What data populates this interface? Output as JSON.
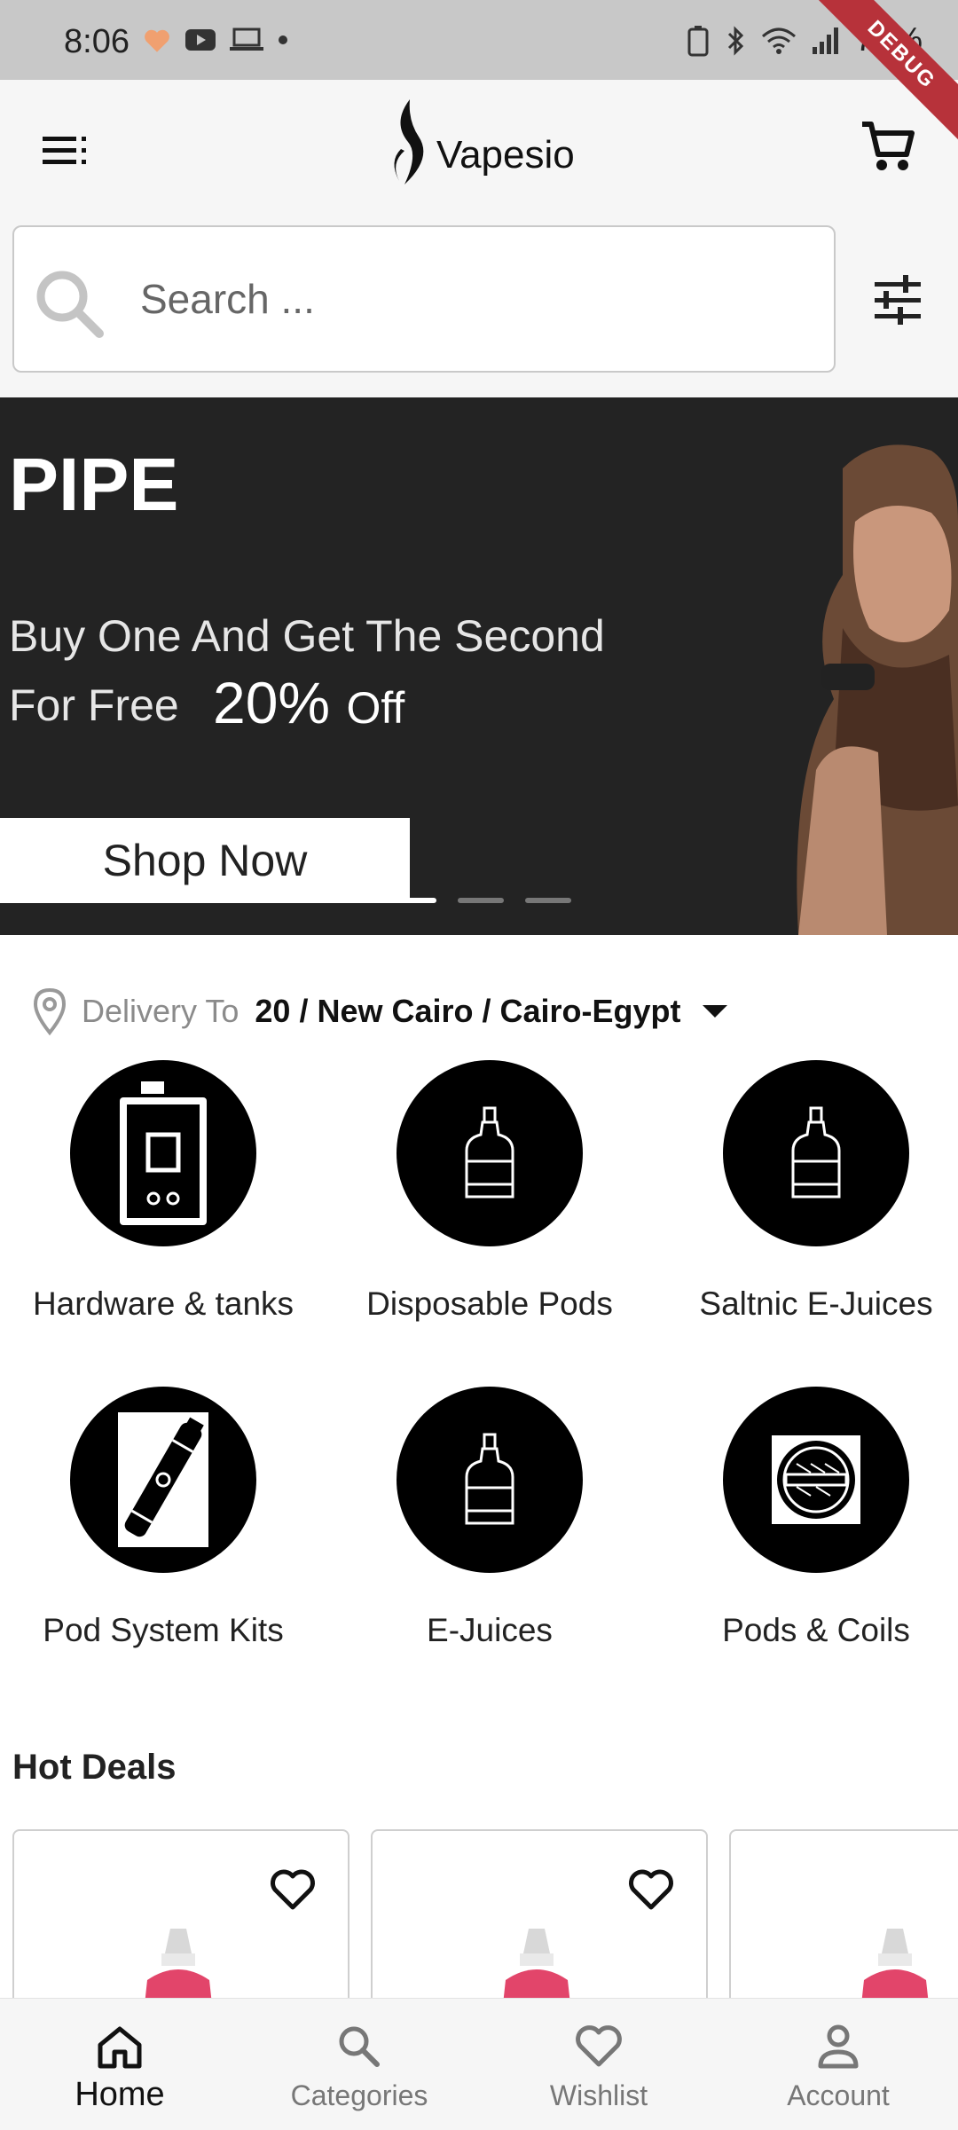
{
  "status_bar": {
    "time": "8:06",
    "battery": "72%"
  },
  "debug_ribbon": "DEBUG",
  "app_bar": {
    "logo_text": "Vapesio",
    "menu_icon": "menu-icon",
    "cart_icon": "cart-icon"
  },
  "search": {
    "placeholder": "Search ...",
    "filter_icon": "filter-icon"
  },
  "banner": {
    "headline": "PIPE",
    "line1": "Buy One And Get The Second",
    "line2": "For Free",
    "discount": "20%",
    "discount_suffix": "Off",
    "cta": "Shop Now",
    "slide_count": 3,
    "active_slide": 1
  },
  "delivery": {
    "label": "Delivery To",
    "address": "20 / New Cairo / Cairo-Egypt"
  },
  "categories": [
    {
      "label": "Hardware & tanks",
      "icon": "hardware-tank-icon"
    },
    {
      "label": "Disposable Pods",
      "icon": "bottle-icon"
    },
    {
      "label": "Saltnic E-Juices",
      "icon": "bottle-icon"
    },
    {
      "label": "Pod System Kits",
      "icon": "pod-kit-icon"
    },
    {
      "label": "E-Juices",
      "icon": "bottle-icon"
    },
    {
      "label": "Pods & Coils",
      "icon": "coil-icon"
    }
  ],
  "hot_deals": {
    "title": "Hot Deals",
    "cards": 3
  },
  "bottom_nav": [
    {
      "label": "Home",
      "icon": "home-icon",
      "active": true
    },
    {
      "label": "Categories",
      "icon": "search-icon",
      "active": false
    },
    {
      "label": "Wishlist",
      "icon": "heart-icon",
      "active": false
    },
    {
      "label": "Account",
      "icon": "person-icon",
      "active": false
    }
  ]
}
